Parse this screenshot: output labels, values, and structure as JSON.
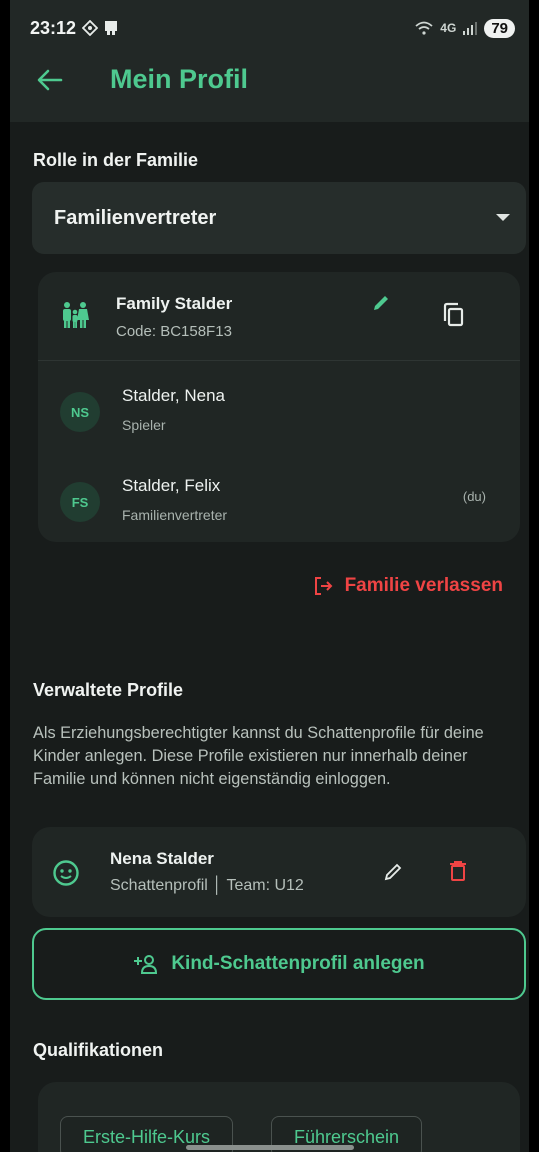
{
  "status_bar": {
    "time": "23:12",
    "signal_text": "4G",
    "battery": "79"
  },
  "header": {
    "title": "Mein Profil"
  },
  "role": {
    "section_label": "Rolle in der Familie",
    "selected": "Familienvertreter"
  },
  "family": {
    "name": "Family Stalder",
    "code": "Code: BC158F13",
    "members": [
      {
        "initials": "NS",
        "name": "Stalder, Nena",
        "role": "Spieler",
        "tag": ""
      },
      {
        "initials": "FS",
        "name": "Stalder, Felix",
        "role": "Familienvertreter",
        "tag": "(du)"
      }
    ],
    "leave_label": "Familie verlassen"
  },
  "managed": {
    "section_label": "Verwaltete Profile",
    "description": "Als Erziehungsberechtigter kannst du Schattenprofile für deine Kinder anlegen. Diese Profile existieren nur innerhalb deiner Familie und können nicht eigenständig einloggen.",
    "profiles": [
      {
        "name": "Nena Stalder",
        "subtitle": "Schattenprofil │ Team: U12"
      }
    ],
    "add_label": "Kind-Schattenprofil anlegen"
  },
  "qualifications": {
    "section_label": "Qualifikationen",
    "items": [
      "Erste-Hilfe-Kurs",
      "Führerschein"
    ]
  },
  "colors": {
    "accent": "#4ec98f",
    "danger": "#ef4444",
    "background": "#181c1b",
    "card": "#202624"
  }
}
